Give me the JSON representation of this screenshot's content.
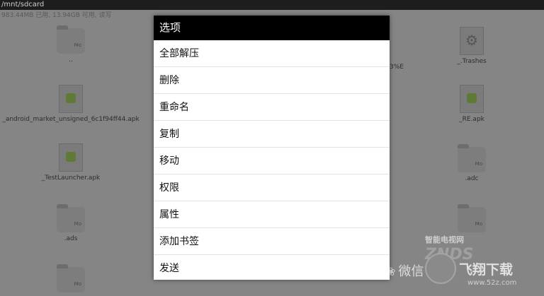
{
  "app": {
    "path": "/mnt/sdcard",
    "storage_info": "983.44MB 已用, 13.94GB 可用, 读写"
  },
  "files": [
    {
      "name": "..",
      "icon": "folder-icon",
      "mark": "Mo"
    },
    {
      "name": "_android_market_unsigned_6c1f94ff44.apk",
      "icon": "apk-icon"
    },
    {
      "name": "_TestLauncher.apk",
      "icon": "apk-icon"
    },
    {
      "name": ".ads",
      "icon": "folder-icon",
      "mark": "Mo"
    },
    {
      "name": "",
      "icon": "folder-icon",
      "mark": "Mo"
    },
    {
      "name": "_.Trashes",
      "icon": "gear-icon"
    },
    {
      "name": "_RE.apk",
      "icon": "apk-icon"
    },
    {
      "name": ".adc",
      "icon": "folder-icon",
      "mark": "Mo"
    },
    {
      "name": "",
      "icon": "folder-icon",
      "mark": "Mo"
    }
  ],
  "partial_label": "3%E",
  "dialog": {
    "title": "选项",
    "items": [
      "全部解压",
      "删除",
      "重命名",
      "复制",
      "移动",
      "权限",
      "属性",
      "添加书签",
      "发送"
    ]
  },
  "watermark": {
    "line1": "智能电视网",
    "line2": "微信",
    "line3": "飞翔下载",
    "line4": "www.52z.com",
    "brand": "ZNDS"
  }
}
